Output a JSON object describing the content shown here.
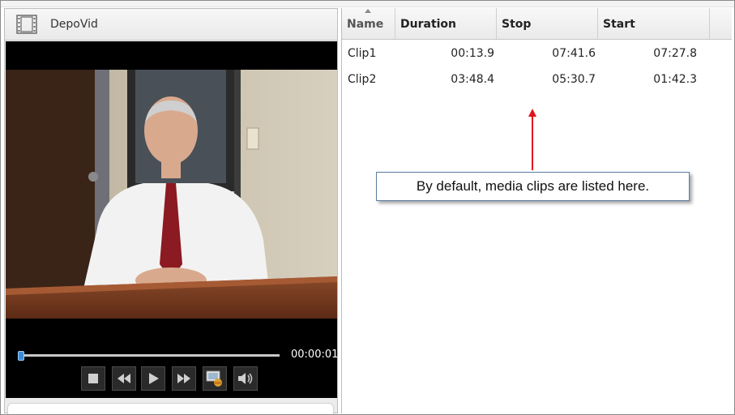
{
  "video_panel": {
    "title": "DepoVid",
    "time": "00:00:01",
    "progress_fraction": 0.005,
    "controls": [
      {
        "name": "stop-button",
        "icon": "stop-icon"
      },
      {
        "name": "rewind-button",
        "icon": "rewind-icon"
      },
      {
        "name": "play-button",
        "icon": "play-icon"
      },
      {
        "name": "fast-forward-button",
        "icon": "fast-forward-icon"
      },
      {
        "name": "snapshot-button",
        "icon": "snapshot-icon"
      },
      {
        "name": "volume-button",
        "icon": "volume-icon"
      }
    ]
  },
  "clips_grid": {
    "columns": [
      "Name",
      "Duration",
      "Stop",
      "Start"
    ],
    "rows": [
      {
        "name": "Clip1",
        "duration": "00:13.9",
        "stop": "07:41.6",
        "start": "07:27.8"
      },
      {
        "name": "Clip2",
        "duration": "03:48.4",
        "stop": "05:30.7",
        "start": "01:42.3"
      }
    ]
  },
  "annotation": {
    "callout_text": "By default, media clips are listed here.",
    "arrow_color": "#e0141e"
  }
}
